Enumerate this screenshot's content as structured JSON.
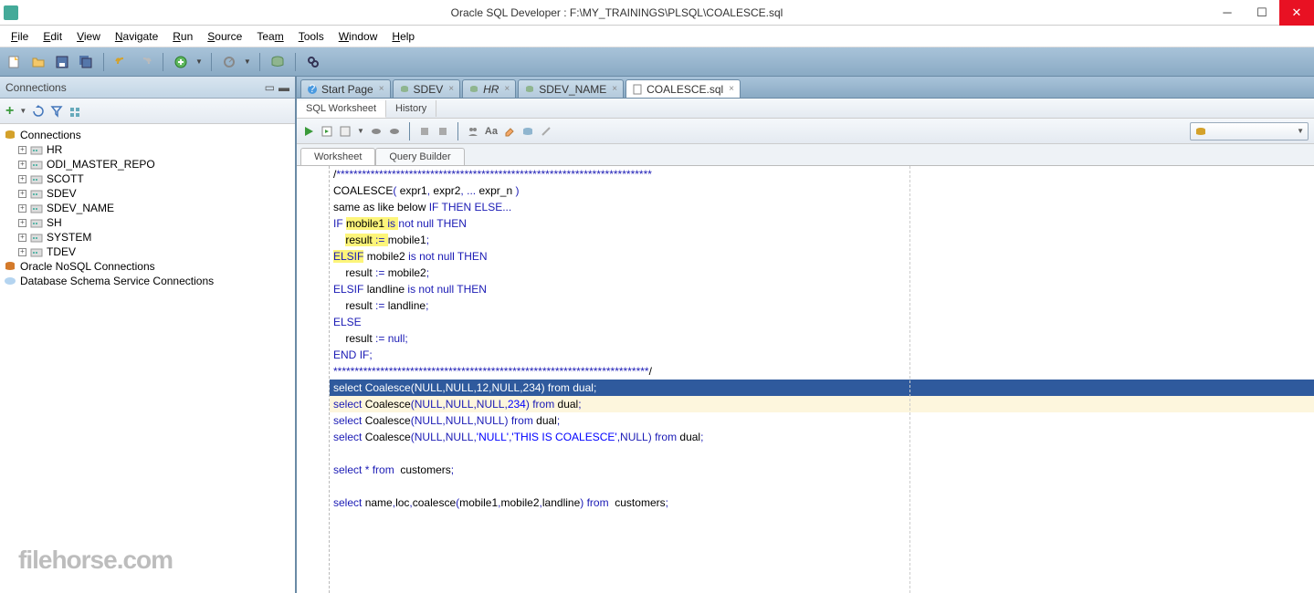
{
  "titlebar": {
    "title": "Oracle SQL Developer : F:\\MY_TRAININGS\\PLSQL\\COALESCE.sql"
  },
  "menu": {
    "file": "File",
    "edit": "Edit",
    "view": "View",
    "navigate": "Navigate",
    "run": "Run",
    "source": "Source",
    "team": "Team",
    "tools": "Tools",
    "window": "Window",
    "help": "Help"
  },
  "sidebar": {
    "title": "Connections",
    "root": "Connections",
    "items": [
      {
        "label": "HR"
      },
      {
        "label": "ODI_MASTER_REPO"
      },
      {
        "label": "SCOTT"
      },
      {
        "label": "SDEV"
      },
      {
        "label": "SDEV_NAME"
      },
      {
        "label": "SH"
      },
      {
        "label": "SYSTEM"
      },
      {
        "label": "TDEV"
      }
    ],
    "nosql": "Oracle NoSQL Connections",
    "dbschema": "Database Schema Service Connections"
  },
  "tabs": [
    {
      "label": "Start Page",
      "icon": "help"
    },
    {
      "label": "SDEV",
      "icon": "sql"
    },
    {
      "label": "HR",
      "icon": "sql",
      "italic": true
    },
    {
      "label": "SDEV_NAME",
      "icon": "sql"
    },
    {
      "label": "COALESCE.sql",
      "icon": "file",
      "active": true
    }
  ],
  "ws_tabs": {
    "sql": "SQL Worksheet",
    "history": "History"
  },
  "sheet_tabs": {
    "worksheet": "Worksheet",
    "query": "Query Builder"
  },
  "code": [
    {
      "t": "/**************************************************************************"
    },
    {
      "t": "COALESCE( expr1, expr2, ... expr_n )"
    },
    {
      "t": "same as like below IF THEN ELSE..."
    },
    {
      "t": "IF mobile1 is not null THEN",
      "hl": [
        3,
        14
      ]
    },
    {
      "t": "    result := mobile1;",
      "hl": [
        4,
        14
      ]
    },
    {
      "t": "ELSIF mobile2 is not null THEN",
      "hlkw": true
    },
    {
      "t": "    result := mobile2;"
    },
    {
      "t": "ELSIF landline is not null THEN"
    },
    {
      "t": "    result := landline;"
    },
    {
      "t": "ELSE"
    },
    {
      "t": "    result := null;"
    },
    {
      "t": "END IF;"
    },
    {
      "t": "**************************************************************************/"
    },
    {
      "t": "select Coalesce(NULL,NULL,12,NULL,234) from dual;",
      "selected": true
    },
    {
      "t": "select Coalesce(NULL,NULL,NULL,234) from dual;",
      "cursor": true
    },
    {
      "t": "select Coalesce(NULL,NULL,NULL) from dual;"
    },
    {
      "t": "select Coalesce(NULL,NULL,'NULL','THIS IS COALESCE',NULL) from dual;"
    },
    {
      "t": ""
    },
    {
      "t": "select * from  customers;"
    },
    {
      "t": ""
    },
    {
      "t": "select name,loc,coalesce(mobile1,mobile2,landline) from  customers;"
    }
  ],
  "watermark": "filehorse.com"
}
